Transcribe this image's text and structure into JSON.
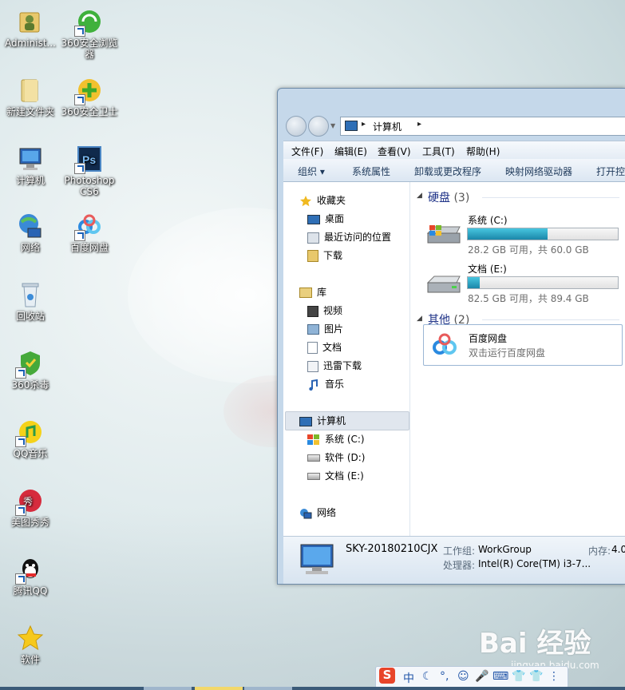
{
  "desktop": {
    "icons": [
      {
        "label": "Administ...",
        "icon": "user-folder-icon"
      },
      {
        "label": "360安全浏览器",
        "icon": "360-browser-icon"
      },
      {
        "label": "新建文件夹",
        "icon": "folder-icon"
      },
      {
        "label": "360安全卫士",
        "icon": "360-guard-icon"
      },
      {
        "label": "计算机",
        "icon": "computer-icon"
      },
      {
        "label": "Photoshop CS6",
        "icon": "photoshop-icon"
      },
      {
        "label": "网络",
        "icon": "network-icon"
      },
      {
        "label": "百度网盘",
        "icon": "baidu-netdisk-icon"
      },
      {
        "label": "回收站",
        "icon": "recycle-bin-icon"
      },
      {
        "label": "360杀毒",
        "icon": "360-antivirus-icon"
      },
      {
        "label": "QQ音乐",
        "icon": "qq-music-icon"
      },
      {
        "label": "美图秀秀",
        "icon": "meitu-icon"
      },
      {
        "label": "腾讯QQ",
        "icon": "qq-icon"
      },
      {
        "label": "软件",
        "icon": "star-icon"
      }
    ]
  },
  "explorer": {
    "address": {
      "crumb": "计算机",
      "sep": "▸"
    },
    "menu": [
      "文件(F)",
      "编辑(E)",
      "查看(V)",
      "工具(T)",
      "帮助(H)"
    ],
    "toolbar": [
      "组织 ▾",
      "系统属性",
      "卸载或更改程序",
      "映射网络驱动器",
      "打开控"
    ],
    "nav": {
      "favorites": {
        "label": "收藏夹",
        "items": [
          "桌面",
          "最近访问的位置",
          "下载"
        ]
      },
      "libraries": {
        "label": "库",
        "items": [
          "视频",
          "图片",
          "文档",
          "迅雷下载",
          "音乐"
        ]
      },
      "computer": {
        "label": "计算机",
        "items": [
          "系统 (C:)",
          "软件 (D:)",
          "文档 (E:)"
        ]
      },
      "network": {
        "label": "网络"
      }
    },
    "groups": {
      "disks": {
        "title": "硬盘",
        "count": "(3)"
      },
      "other": {
        "title": "其他",
        "count": "(2)"
      }
    },
    "drives": [
      {
        "name": "系统 (C:)",
        "info": "28.2 GB 可用，共 60.0 GB",
        "used_fraction": 0.53
      },
      {
        "name": "文档 (E:)",
        "info": "82.5 GB 可用，共 89.4 GB",
        "used_fraction": 0.08
      }
    ],
    "other_item": {
      "name": "百度网盘",
      "desc": "双击运行百度网盘"
    },
    "status": {
      "computer_name": "SKY-20180210CJX",
      "workgroup_label": "工作组:",
      "workgroup": "WorkGroup",
      "memory_label": "内存:",
      "memory": "4.0",
      "cpu_label": "处理器:",
      "cpu": "Intel(R) Core(TM) i3-7..."
    }
  },
  "tray": {
    "items": [
      "S",
      "中",
      "☾",
      "°,",
      "☺",
      "🎤",
      "⌨",
      "👕",
      "👕",
      "⋮"
    ]
  },
  "watermark": {
    "text": "Bai 经验",
    "sub": "jingyan.baidu.com"
  },
  "colors": {
    "accent": "#1e3287",
    "bar_fill": "#26a0c4",
    "selection": "#e0e6ee"
  }
}
